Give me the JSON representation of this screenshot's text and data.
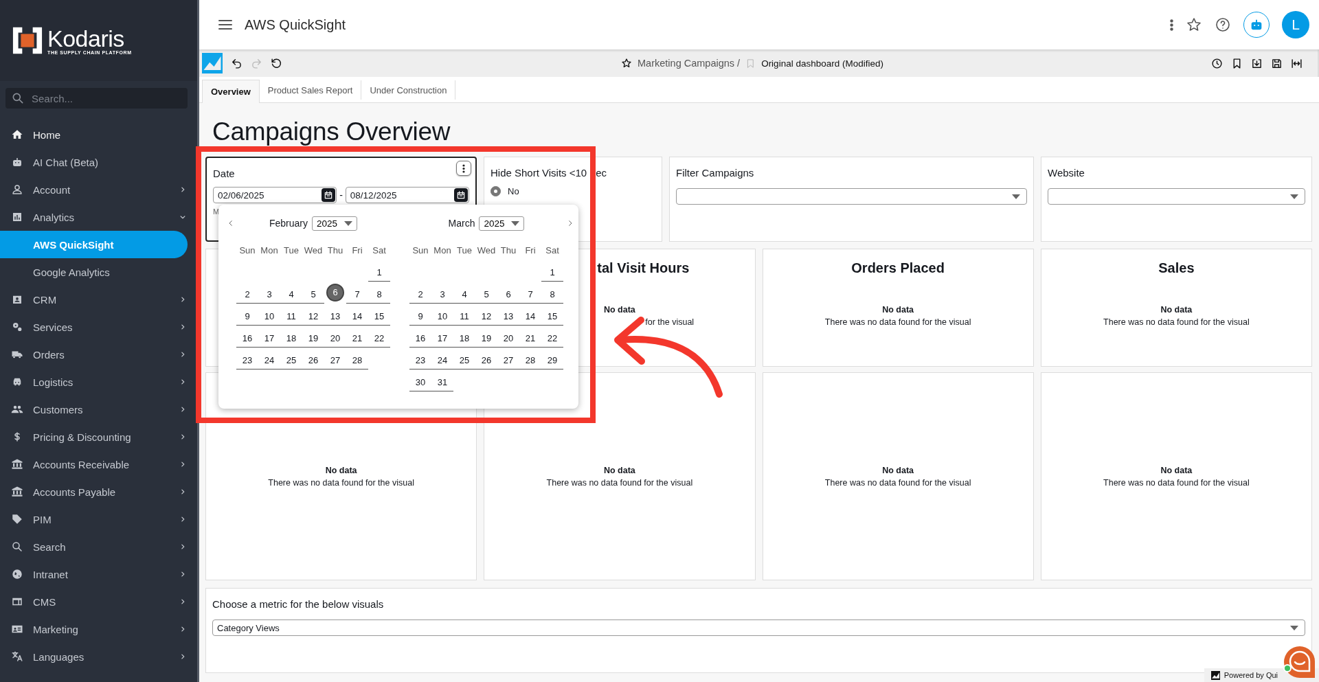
{
  "sidebar": {
    "logo": {
      "name": "Kodaris",
      "tagline": "THE SUPPLY CHAIN PLATFORM"
    },
    "search": {
      "placeholder": "Search..."
    },
    "items": [
      {
        "label": "Home",
        "selected": false
      },
      {
        "label": "AI Chat (Beta)",
        "selected": false
      },
      {
        "label": "Account",
        "selected": false,
        "expanded": false
      },
      {
        "label": "Analytics",
        "selected": false,
        "expanded": true,
        "children": [
          {
            "label": "AWS QuickSight",
            "selected": true
          },
          {
            "label": "Google Analytics",
            "selected": false
          }
        ]
      },
      {
        "label": "CRM",
        "selected": false,
        "expanded": false
      },
      {
        "label": "Services",
        "selected": false,
        "expanded": false
      },
      {
        "label": "Orders",
        "selected": false,
        "expanded": false
      },
      {
        "label": "Logistics",
        "selected": false,
        "expanded": false
      },
      {
        "label": "Customers",
        "selected": false,
        "expanded": false
      },
      {
        "label": "Pricing & Discounting",
        "selected": false,
        "expanded": false
      },
      {
        "label": "Accounts Receivable",
        "selected": false,
        "expanded": false
      },
      {
        "label": "Accounts Payable",
        "selected": false,
        "expanded": false
      },
      {
        "label": "PIM",
        "selected": false,
        "expanded": false
      },
      {
        "label": "Search",
        "selected": false,
        "expanded": false
      },
      {
        "label": "Intranet",
        "selected": false,
        "expanded": false
      },
      {
        "label": "CMS",
        "selected": false,
        "expanded": false
      },
      {
        "label": "Marketing",
        "selected": false,
        "expanded": false
      },
      {
        "label": "Languages",
        "selected": false,
        "expanded": false
      }
    ]
  },
  "topbar": {
    "title": "AWS QuickSight",
    "avatar": "L"
  },
  "toolbar": {
    "history_buttons": [
      {
        "kind": "undo",
        "disabled": false
      },
      {
        "kind": "redo",
        "disabled": true
      },
      {
        "kind": "reset",
        "disabled": false
      }
    ],
    "breadcrumb": {
      "parent": "Marketing Campaigns /",
      "current": "Original dashboard (Modified)"
    }
  },
  "tabs": [
    {
      "label": "Overview",
      "selected": true
    },
    {
      "label": "Product Sales Report",
      "selected": false
    },
    {
      "label": "Under Construction",
      "selected": false
    }
  ],
  "dashboard": {
    "title": "Campaigns Overview",
    "date_control": {
      "label": "Date",
      "from": "02/06/2025",
      "separator": "-",
      "to": "08/12/2025",
      "note": "M"
    },
    "date_picker": {
      "months": [
        {
          "name": "February",
          "year": "2025",
          "weekdays": [
            "Sun",
            "Mon",
            "Tue",
            "Wed",
            "Thu",
            "Fri",
            "Sat"
          ],
          "weeks": [
            [
              {
                "day": "1",
                "selected": false
              }
            ],
            [
              {
                "day": "2",
                "selected": false
              },
              {
                "day": "3",
                "selected": false
              },
              {
                "day": "4",
                "selected": false
              },
              {
                "day": "5",
                "selected": false
              },
              {
                "day": "6",
                "selected": true
              },
              {
                "day": "7",
                "selected": false
              },
              {
                "day": "8",
                "selected": false
              }
            ],
            [
              {
                "day": "9",
                "selected": false
              },
              {
                "day": "10",
                "selected": false
              },
              {
                "day": "11",
                "selected": false
              },
              {
                "day": "12",
                "selected": false
              },
              {
                "day": "13",
                "selected": false
              },
              {
                "day": "14",
                "selected": false
              },
              {
                "day": "15",
                "selected": false
              }
            ],
            [
              {
                "day": "16",
                "selected": false
              },
              {
                "day": "17",
                "selected": false
              },
              {
                "day": "18",
                "selected": false
              },
              {
                "day": "19",
                "selected": false
              },
              {
                "day": "20",
                "selected": false
              },
              {
                "day": "21",
                "selected": false
              },
              {
                "day": "22",
                "selected": false
              }
            ],
            [
              {
                "day": "23",
                "selected": false
              },
              {
                "day": "24",
                "selected": false
              },
              {
                "day": "25",
                "selected": false
              },
              {
                "day": "26",
                "selected": false
              },
              {
                "day": "27",
                "selected": false
              },
              {
                "day": "28",
                "selected": false
              }
            ]
          ]
        },
        {
          "name": "March",
          "year": "2025",
          "weekdays": [
            "Sun",
            "Mon",
            "Tue",
            "Wed",
            "Thu",
            "Fri",
            "Sat"
          ],
          "weeks": [
            [
              {
                "day": "1",
                "selected": false
              }
            ],
            [
              {
                "day": "2",
                "selected": false
              },
              {
                "day": "3",
                "selected": false
              },
              {
                "day": "4",
                "selected": false
              },
              {
                "day": "5",
                "selected": false
              },
              {
                "day": "6",
                "selected": false
              },
              {
                "day": "7",
                "selected": false
              },
              {
                "day": "8",
                "selected": false
              }
            ],
            [
              {
                "day": "9",
                "selected": false
              },
              {
                "day": "10",
                "selected": false
              },
              {
                "day": "11",
                "selected": false
              },
              {
                "day": "12",
                "selected": false
              },
              {
                "day": "13",
                "selected": false
              },
              {
                "day": "14",
                "selected": false
              },
              {
                "day": "15",
                "selected": false
              }
            ],
            [
              {
                "day": "16",
                "selected": false
              },
              {
                "day": "17",
                "selected": false
              },
              {
                "day": "18",
                "selected": false
              },
              {
                "day": "19",
                "selected": false
              },
              {
                "day": "20",
                "selected": false
              },
              {
                "day": "21",
                "selected": false
              },
              {
                "day": "22",
                "selected": false
              }
            ],
            [
              {
                "day": "23",
                "selected": false
              },
              {
                "day": "24",
                "selected": false
              },
              {
                "day": "25",
                "selected": false
              },
              {
                "day": "26",
                "selected": false
              },
              {
                "day": "27",
                "selected": false
              },
              {
                "day": "28",
                "selected": false
              },
              {
                "day": "29",
                "selected": false
              }
            ],
            [
              {
                "day": "30",
                "selected": false
              },
              {
                "day": "31",
                "selected": false
              }
            ]
          ]
        }
      ]
    },
    "hide_short_visits": {
      "label": "Hide Short Visits <10",
      "label_tail": "ec",
      "options": [
        {
          "label": "No",
          "selected": true
        }
      ]
    },
    "filter_campaigns": {
      "label": "Filter Campaigns"
    },
    "website": {
      "label": "Website"
    },
    "kpi_visuals": [
      {
        "kind": "covered",
        "title": "tal Visit Hours",
        "message": "No data",
        "detail": "for the visual"
      },
      {
        "title": "Orders Placed",
        "message": "No data",
        "detail": "There was no data found for the visual"
      },
      {
        "title": "Sales",
        "message": "No data",
        "detail": "There was no data found for the visual"
      }
    ],
    "chart_visuals": [
      {
        "message": "No data",
        "detail": "There was no data found for the visual"
      },
      {
        "message": "No data",
        "detail": "There was no data found for the visual"
      },
      {
        "message": "No data",
        "detail": "There was no data found for the visual"
      },
      {
        "message": "No data",
        "detail": "There was no data found for the visual"
      }
    ],
    "metric": {
      "label": "Choose a metric for the below visuals",
      "value": "Category Views"
    }
  },
  "footer": {
    "powered_by": "Powered by Qui"
  }
}
